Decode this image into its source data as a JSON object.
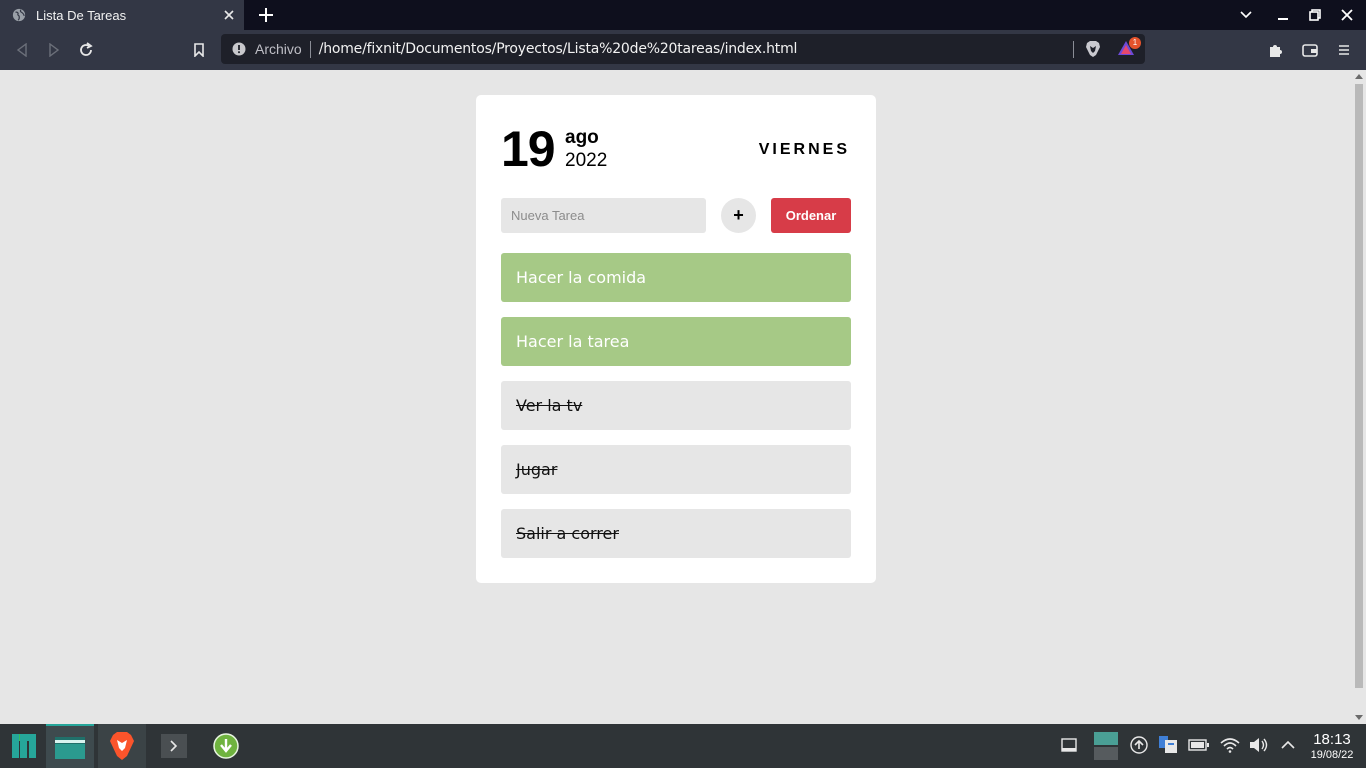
{
  "browser": {
    "tab_title": "Lista De Tareas",
    "url_label": "Archivo",
    "url": "/home/fixnit/Documentos/Proyectos/Lista%20de%20tareas/index.html",
    "rewards_badge": "1"
  },
  "page": {
    "day": "19",
    "month": "ago",
    "year": "2022",
    "weekday": "VIERNES",
    "input_placeholder": "Nueva Tarea",
    "add_label": "+",
    "order_label": "Ordenar",
    "tasks": [
      {
        "label": "Hacer la comida",
        "status": "pending"
      },
      {
        "label": "Hacer la tarea",
        "status": "pending"
      },
      {
        "label": "Ver la tv",
        "status": "done"
      },
      {
        "label": "Jugar",
        "status": "done"
      },
      {
        "label": "Salir a correr",
        "status": "done"
      }
    ]
  },
  "taskbar": {
    "time": "18:13",
    "date": "19/08/22"
  },
  "colors": {
    "pending_task": "#a6c986",
    "done_task": "#e6e6e6",
    "order_button": "#d73c48",
    "accent": "#26a69a"
  }
}
